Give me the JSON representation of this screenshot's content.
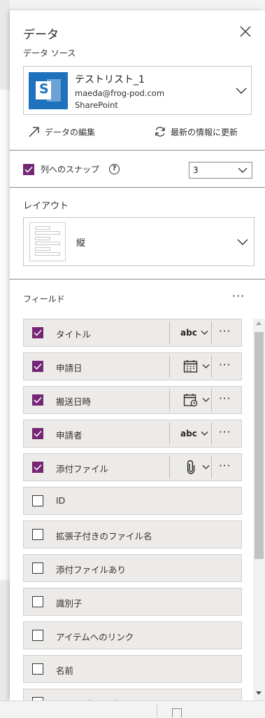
{
  "panel": {
    "title": "データ",
    "close_icon": "close-icon"
  },
  "data_source": {
    "label": "データ ソース",
    "name": "テストリスト_1",
    "email": "maeda@frog-pod.com",
    "type": "SharePoint",
    "logo_icon": "sharepoint-icon",
    "logo_letter": "S"
  },
  "actions": {
    "edit_data": "データの編集",
    "refresh": "最新の情報に更新"
  },
  "snap": {
    "label": "列へのスナップ",
    "checked": true,
    "help_symbol": "?",
    "columns_value": "3"
  },
  "layout": {
    "label": "レイアウト",
    "value": "縦"
  },
  "fields": {
    "label": "フィールド",
    "more_symbol": "···",
    "items": [
      {
        "label": "タイトル",
        "checked": true,
        "control": "abc",
        "control_icon": "text-icon"
      },
      {
        "label": "申請日",
        "checked": true,
        "control": "",
        "control_icon": "calendar-icon"
      },
      {
        "label": "搬送日時",
        "checked": true,
        "control": "",
        "control_icon": "calendar-clock-icon"
      },
      {
        "label": "申請者",
        "checked": true,
        "control": "abc",
        "control_icon": "text-icon"
      },
      {
        "label": "添付ファイル",
        "checked": true,
        "control": "",
        "control_icon": "paperclip-icon"
      },
      {
        "label": "ID",
        "checked": false
      },
      {
        "label": "拡張子付きのファイル名",
        "checked": false
      },
      {
        "label": "添付ファイルあり",
        "checked": false
      },
      {
        "label": "識別子",
        "checked": false
      },
      {
        "label": "アイテムへのリンク",
        "checked": false
      },
      {
        "label": "名前",
        "checked": false
      },
      {
        "label": "フォルダーのパス",
        "checked": false
      }
    ]
  },
  "colors": {
    "accent": "#742774",
    "sharepoint": "#1e72bd",
    "field_bg": "#edebe9"
  }
}
